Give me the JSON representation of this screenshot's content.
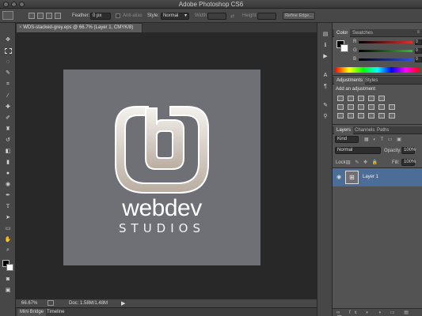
{
  "app": {
    "title": "Adobe Photoshop CS6"
  },
  "options_bar": {
    "feather_label": "Feather:",
    "feather_value": "0 px",
    "antialias_label": "Anti-alias",
    "style_label": "Style:",
    "style_value": "Normal",
    "width_label": "Width:",
    "height_label": "Height:",
    "refine_edge_label": "Refine Edge..."
  },
  "document": {
    "tab_title": "WDS-stacked-grey.eps @ 66.7% (Layer 1, CMYK/8)",
    "logo_word1": "webdev",
    "logo_word2": "STUDIOS",
    "canvas_color": "#6f6f76"
  },
  "status": {
    "zoom": "66.67%",
    "doc_info": "Doc: 1.58M/1.48M"
  },
  "bottom_tabs": [
    "Mini Bridge",
    "Timeline"
  ],
  "color_panel": {
    "tabs": [
      "Color",
      "Swatches"
    ],
    "channels": [
      {
        "label": "R",
        "value": "0",
        "color": "#e03030"
      },
      {
        "label": "G",
        "value": "0",
        "color": "#30c030"
      },
      {
        "label": "B",
        "value": "0",
        "color": "#3050e0"
      }
    ]
  },
  "adjustments_panel": {
    "tabs": [
      "Adjustments",
      "Styles"
    ],
    "heading": "Add an adjustment"
  },
  "layers_panel": {
    "tabs": [
      "Layers",
      "Channels",
      "Paths"
    ],
    "kind_label": "Kind",
    "blend_mode": "Normal",
    "opacity_label": "Opacity:",
    "opacity_value": "100%",
    "lock_label": "Lock:",
    "fill_label": "Fill:",
    "fill_value": "100%",
    "layers": [
      {
        "name": "Layer 1"
      }
    ]
  }
}
